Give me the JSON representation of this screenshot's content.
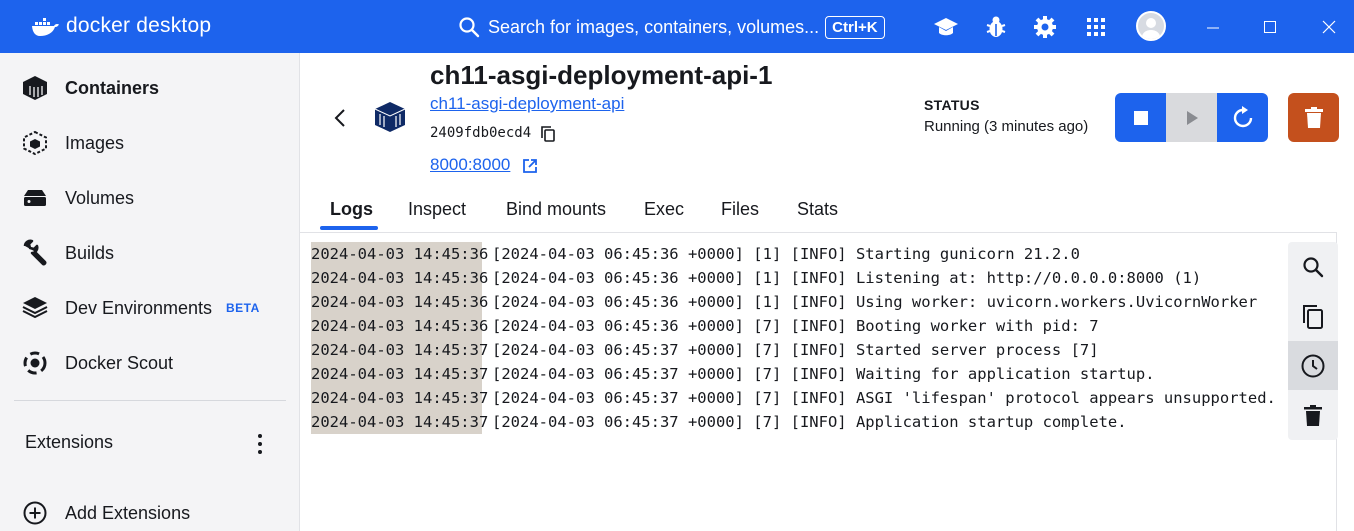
{
  "app": {
    "brand": "docker desktop"
  },
  "search": {
    "label": "Search for images, containers, volumes...",
    "shortcut": "Ctrl+K"
  },
  "sidebar": {
    "items": [
      {
        "label": "Containers",
        "icon": "containers-icon",
        "active": true
      },
      {
        "label": "Images",
        "icon": "images-icon"
      },
      {
        "label": "Volumes",
        "icon": "volumes-icon"
      },
      {
        "label": "Builds",
        "icon": "wrench-icon"
      },
      {
        "label": "Dev Environments",
        "icon": "dev-env-icon",
        "badge": "BETA"
      },
      {
        "label": "Docker Scout",
        "icon": "scout-icon"
      }
    ],
    "extensions": {
      "title": "Extensions",
      "add_label": "Add Extensions"
    }
  },
  "container": {
    "name": "ch11-asgi-deployment-api-1",
    "image_link": "ch11-asgi-deployment-api",
    "id": "2409fdb0ecd4",
    "port": "8000:8000",
    "status_heading": "STATUS",
    "status_value": "Running (3 minutes ago)"
  },
  "tabs": [
    {
      "label": "Logs",
      "active": true
    },
    {
      "label": "Inspect"
    },
    {
      "label": "Bind mounts"
    },
    {
      "label": "Exec"
    },
    {
      "label": "Files"
    },
    {
      "label": "Stats"
    }
  ],
  "logs": [
    {
      "ts": "2024-04-03 14:45:36",
      "msg": "[2024-04-03 06:45:36 +0000] [1] [INFO] Starting gunicorn 21.2.0"
    },
    {
      "ts": "2024-04-03 14:45:36",
      "msg": "[2024-04-03 06:45:36 +0000] [1] [INFO] Listening at: http://0.0.0.0:8000 (1)"
    },
    {
      "ts": "2024-04-03 14:45:36",
      "msg": "[2024-04-03 06:45:36 +0000] [1] [INFO] Using worker: uvicorn.workers.UvicornWorker"
    },
    {
      "ts": "2024-04-03 14:45:36",
      "msg": "[2024-04-03 06:45:36 +0000] [7] [INFO] Booting worker with pid: 7"
    },
    {
      "ts": "2024-04-03 14:45:37",
      "msg": "[2024-04-03 06:45:37 +0000] [7] [INFO] Started server process [7]"
    },
    {
      "ts": "2024-04-03 14:45:37",
      "msg": "[2024-04-03 06:45:37 +0000] [7] [INFO] Waiting for application startup."
    },
    {
      "ts": "2024-04-03 14:45:37",
      "msg": "[2024-04-03 06:45:37 +0000] [7] [INFO] ASGI 'lifespan' protocol appears unsupported."
    },
    {
      "ts": "2024-04-03 14:45:37",
      "msg": "[2024-04-03 06:45:37 +0000] [7] [INFO] Application startup complete."
    }
  ],
  "colors": {
    "brand_blue": "#1d63ed",
    "delete_orange": "#c4501d",
    "timestamp_bg": "#d8d2ca"
  }
}
